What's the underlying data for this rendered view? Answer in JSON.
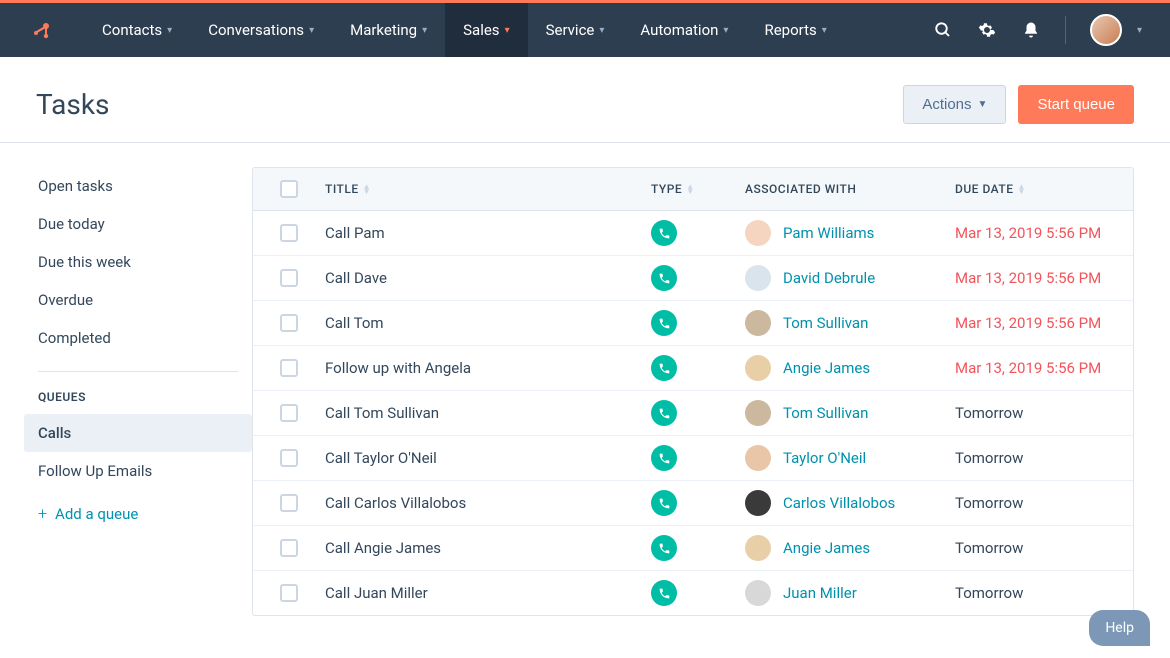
{
  "nav": {
    "items": [
      {
        "label": "Contacts"
      },
      {
        "label": "Conversations"
      },
      {
        "label": "Marketing"
      },
      {
        "label": "Sales",
        "active": true
      },
      {
        "label": "Service"
      },
      {
        "label": "Automation"
      },
      {
        "label": "Reports"
      }
    ]
  },
  "header": {
    "title": "Tasks",
    "actions_label": "Actions",
    "start_queue_label": "Start queue"
  },
  "sidebar": {
    "filters": [
      {
        "label": "Open tasks"
      },
      {
        "label": "Due today"
      },
      {
        "label": "Due this week"
      },
      {
        "label": "Overdue"
      },
      {
        "label": "Completed"
      }
    ],
    "queues_heading": "QUEUES",
    "queues": [
      {
        "label": "Calls",
        "active": true
      },
      {
        "label": "Follow Up Emails"
      }
    ],
    "add_queue_label": "Add a queue"
  },
  "table": {
    "columns": {
      "title": "TITLE",
      "type": "TYPE",
      "associated": "ASSOCIATED WITH",
      "due": "DUE DATE"
    },
    "rows": [
      {
        "title": "Call Pam",
        "type": "call",
        "assoc_name": "Pam Williams",
        "avatar_bg": "#f5d5c0",
        "due": "Mar 13, 2019 5:56 PM",
        "overdue": true
      },
      {
        "title": "Call Dave",
        "type": "call",
        "assoc_name": "David Debrule",
        "avatar_bg": "#d9e4ed",
        "due": "Mar 13, 2019 5:56 PM",
        "overdue": true
      },
      {
        "title": "Call Tom",
        "type": "call",
        "assoc_name": "Tom Sullivan",
        "avatar_bg": "#cbb89e",
        "due": "Mar 13, 2019 5:56 PM",
        "overdue": true
      },
      {
        "title": "Follow up with Angela",
        "type": "call",
        "assoc_name": "Angie James",
        "avatar_bg": "#e8cfa8",
        "due": "Mar 13, 2019 5:56 PM",
        "overdue": true
      },
      {
        "title": "Call Tom Sullivan",
        "type": "call",
        "assoc_name": "Tom Sullivan",
        "avatar_bg": "#cbb89e",
        "due": "Tomorrow",
        "overdue": false
      },
      {
        "title": "Call Taylor O'Neil",
        "type": "call",
        "assoc_name": "Taylor O'Neil",
        "avatar_bg": "#e9c6a8",
        "due": "Tomorrow",
        "overdue": false
      },
      {
        "title": "Call Carlos Villalobos",
        "type": "call",
        "assoc_name": "Carlos Villalobos",
        "avatar_bg": "#3a3a3a",
        "due": "Tomorrow",
        "overdue": false
      },
      {
        "title": "Call Angie James",
        "type": "call",
        "assoc_name": "Angie James",
        "avatar_bg": "#e8cfa8",
        "due": "Tomorrow",
        "overdue": false
      },
      {
        "title": "Call Juan Miller",
        "type": "call",
        "assoc_name": "Juan Miller",
        "avatar_bg": "#d8d8d8",
        "due": "Tomorrow",
        "overdue": false
      }
    ]
  },
  "help_label": "Help"
}
